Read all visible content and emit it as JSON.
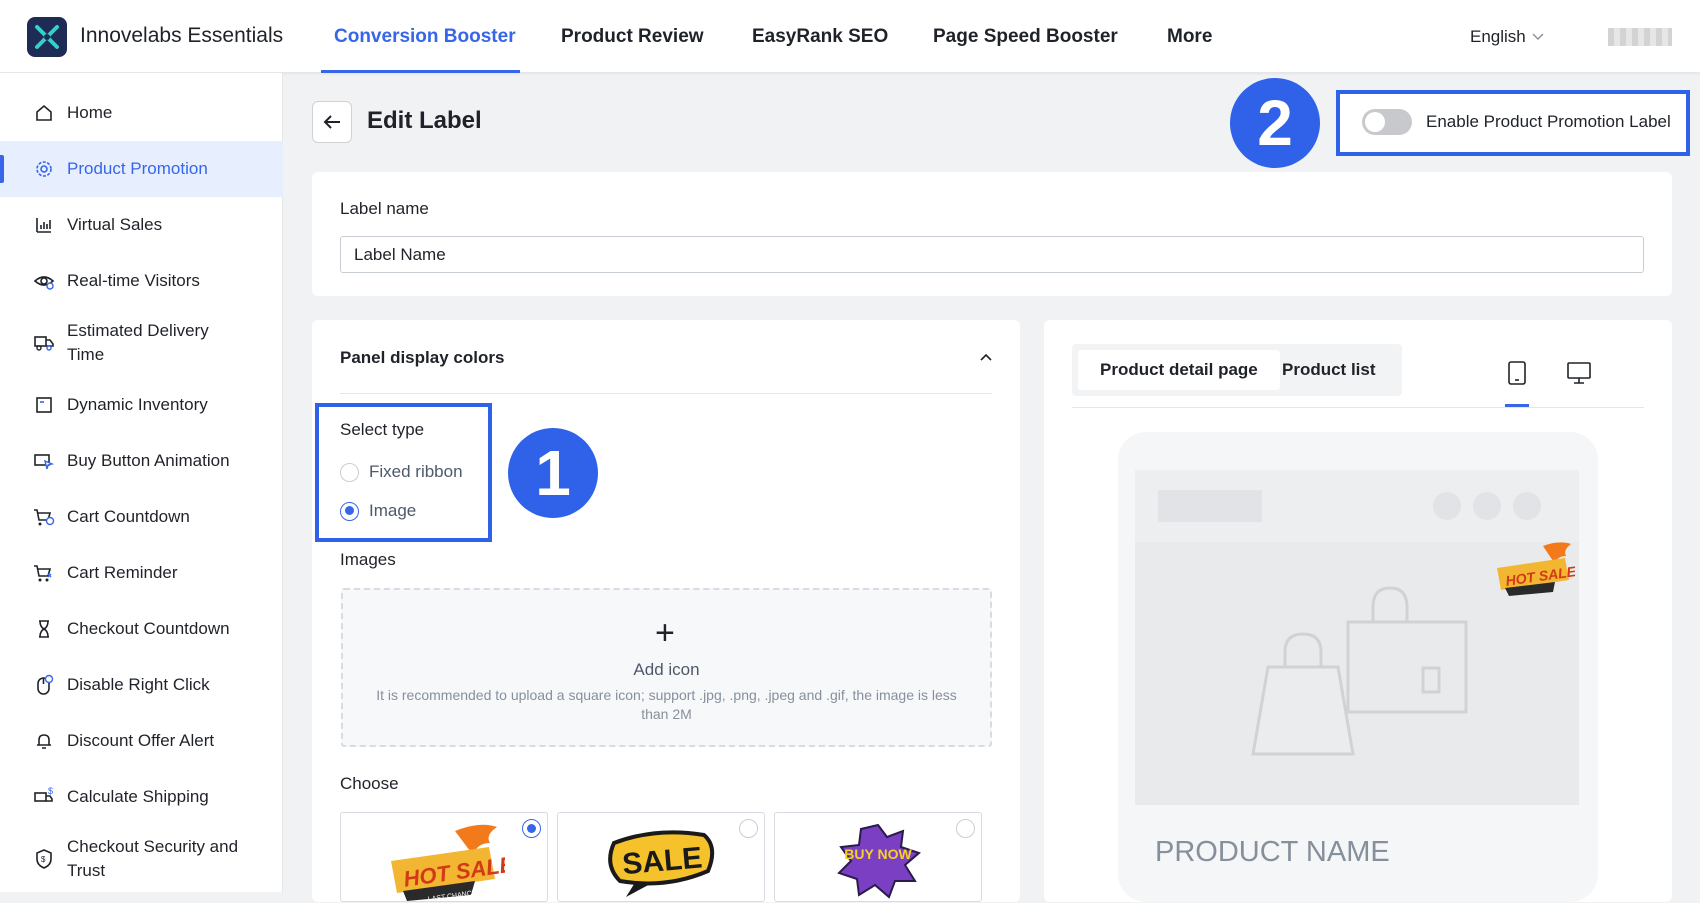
{
  "app": {
    "title": "Innovelabs Essentials"
  },
  "nav": {
    "tabs": [
      {
        "label": "Conversion Booster",
        "active": true
      },
      {
        "label": "Product Review"
      },
      {
        "label": "EasyRank SEO"
      },
      {
        "label": "Page Speed Booster"
      },
      {
        "label": "More"
      }
    ],
    "language": "English"
  },
  "sidebar": {
    "items": [
      {
        "label": "Home",
        "icon": "home-icon"
      },
      {
        "label": "Product Promotion",
        "icon": "gear-icon",
        "active": true
      },
      {
        "label": "Virtual Sales",
        "icon": "bar-chart-icon"
      },
      {
        "label": "Real-time Visitors",
        "icon": "eye-icon"
      },
      {
        "label": "Estimated Delivery Time",
        "icon": "truck-icon"
      },
      {
        "label": "Dynamic Inventory",
        "icon": "inventory-icon"
      },
      {
        "label": "Buy Button Animation",
        "icon": "cursor-click-icon"
      },
      {
        "label": "Cart Countdown",
        "icon": "cart-clock-icon"
      },
      {
        "label": "Cart Reminder",
        "icon": "cart-reminder-icon"
      },
      {
        "label": "Checkout Countdown",
        "icon": "hourglass-icon"
      },
      {
        "label": "Disable Right Click",
        "icon": "mouse-icon"
      },
      {
        "label": "Discount Offer Alert",
        "icon": "bell-icon"
      },
      {
        "label": "Calculate Shipping",
        "icon": "shipping-dollar-icon"
      },
      {
        "label": "Checkout Security and Trust",
        "icon": "shield-icon"
      }
    ]
  },
  "page": {
    "title": "Edit Label",
    "enable_label": "Enable Product Promotion Label",
    "enable_on": false,
    "badges": [
      "1",
      "2"
    ]
  },
  "label_name": {
    "label": "Label name",
    "value": "Label Name"
  },
  "panel": {
    "title": "Panel display colors",
    "select_type_label": "Select type",
    "options": [
      {
        "label": "Fixed ribbon",
        "selected": false
      },
      {
        "label": "Image",
        "selected": true
      }
    ],
    "images_label": "Images",
    "upload": {
      "title": "Add icon",
      "hint": "It is recommended to upload a square icon; support .jpg, .png, .jpeg and .gif, the image is less than 2M"
    },
    "choose_label": "Choose",
    "choices": [
      {
        "text": "HOT SALE",
        "sub": "LAST CHANCE",
        "selected": true
      },
      {
        "text": "SALE",
        "selected": false
      },
      {
        "text": "BUY NOW",
        "selected": false
      }
    ]
  },
  "preview": {
    "tabs": [
      {
        "label": "Product detail page",
        "active": true
      },
      {
        "label": "Product list",
        "active": false
      }
    ],
    "devices": [
      "mobile-icon",
      "desktop-icon"
    ],
    "active_device": "mobile-icon",
    "label_text": "HOT SALE",
    "product_name": "PRODUCT NAME"
  },
  "colors": {
    "accent": "#3766e8",
    "highlight": "#2f62e8"
  }
}
